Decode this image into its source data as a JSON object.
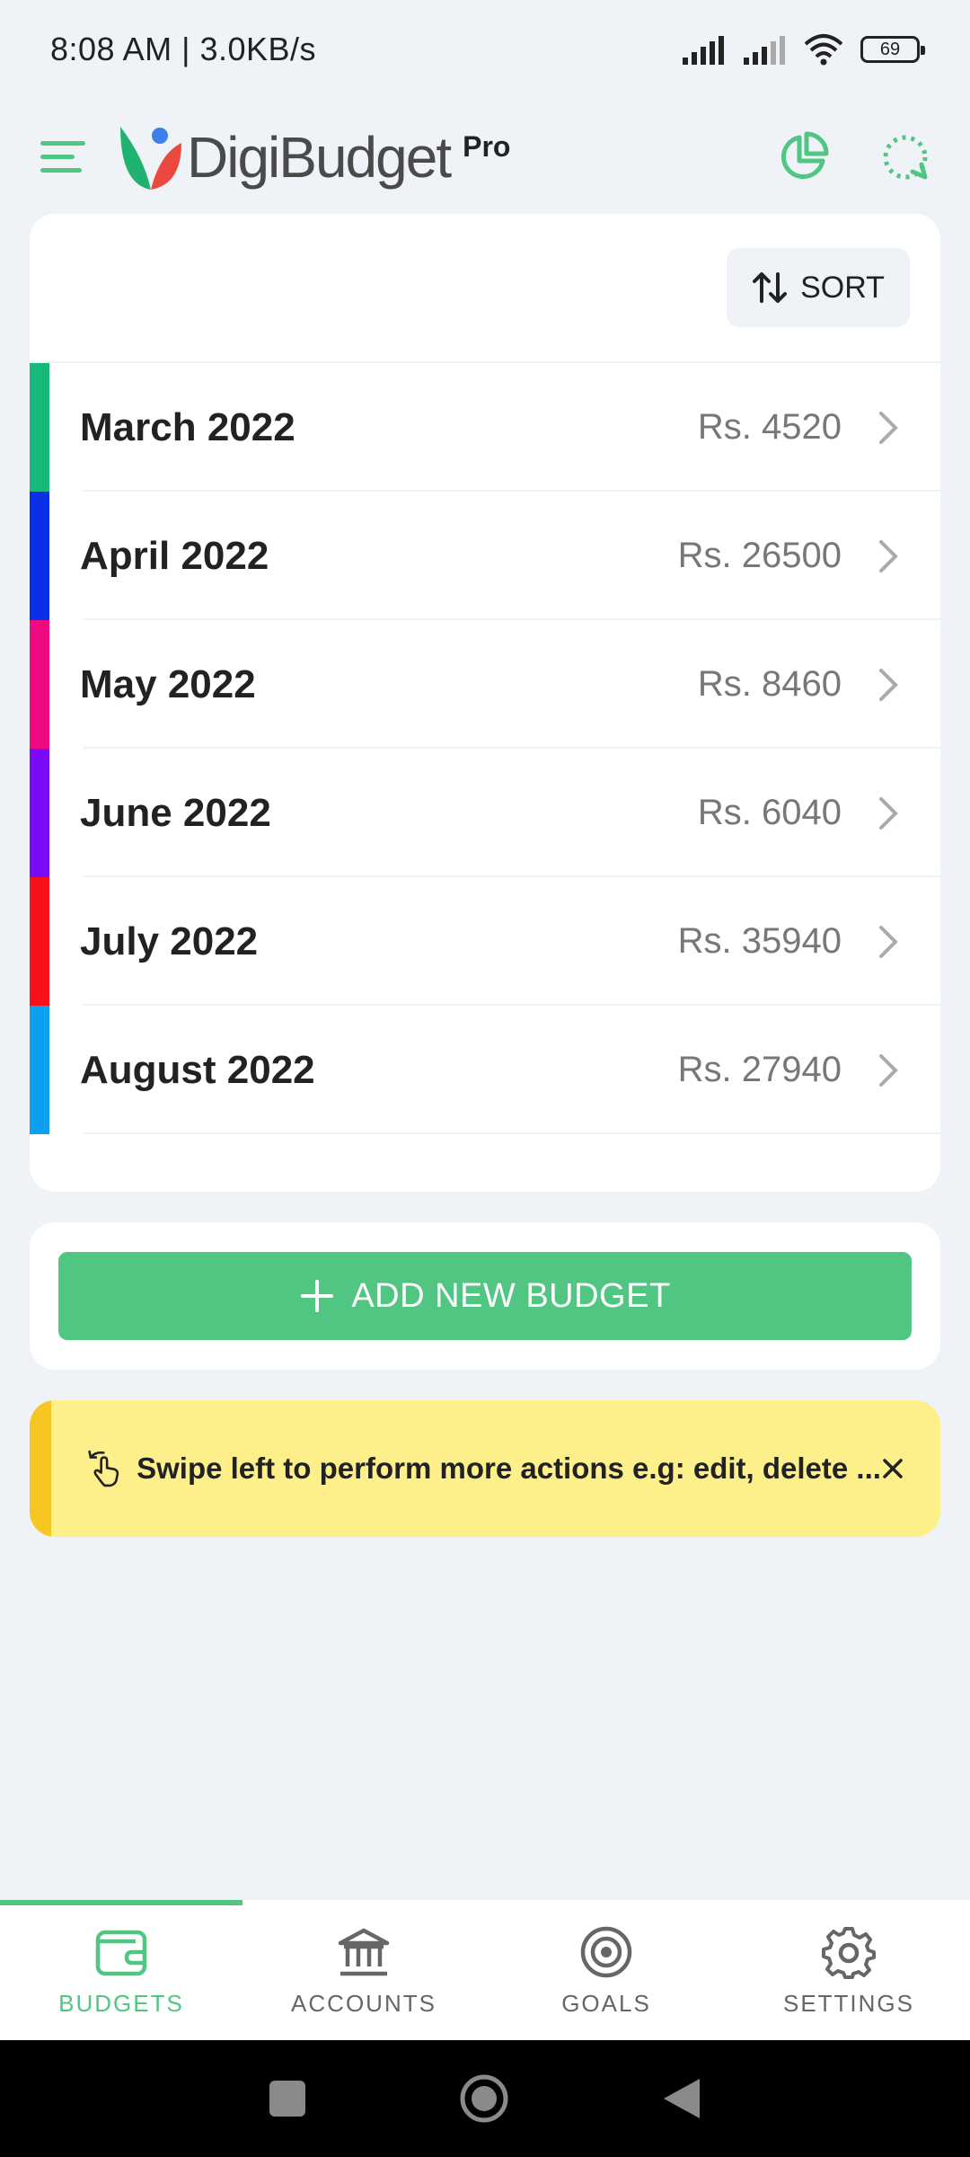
{
  "status_bar": {
    "time_speed": "8:08 AM | 3.0KB/s",
    "battery": "69"
  },
  "app_bar": {
    "logo_text": "DigiBudget",
    "logo_badge": "Pro"
  },
  "budget_list": {
    "sort_label": "SORT",
    "items": [
      {
        "name": "March 2022",
        "amount": "Rs. 4520",
        "color": "#16b97a"
      },
      {
        "name": "April 2022",
        "amount": "Rs. 26500",
        "color": "#0b2ee8"
      },
      {
        "name": "May 2022",
        "amount": "Rs. 8460",
        "color": "#ef0a84"
      },
      {
        "name": "June 2022",
        "amount": "Rs. 6040",
        "color": "#7a0af5"
      },
      {
        "name": "July 2022",
        "amount": "Rs. 35940",
        "color": "#f8101a"
      },
      {
        "name": "August 2022",
        "amount": "Rs. 27940",
        "color": "#0e9ff0"
      }
    ]
  },
  "add_budget": {
    "label": "ADD NEW BUDGET"
  },
  "hint": {
    "text": "Swipe left to perform more actions e.g: edit, delete ..."
  },
  "bottom_nav": {
    "items": [
      {
        "label": "BUDGETS",
        "icon": "wallet-icon",
        "active": true
      },
      {
        "label": "ACCOUNTS",
        "icon": "bank-icon",
        "active": false
      },
      {
        "label": "GOALS",
        "icon": "target-icon",
        "active": false
      },
      {
        "label": "SETTINGS",
        "icon": "gear-icon",
        "active": false
      }
    ]
  },
  "colors": {
    "accent": "#51c683",
    "hint_bg": "#fdef8a",
    "hint_bar": "#f7c623"
  }
}
